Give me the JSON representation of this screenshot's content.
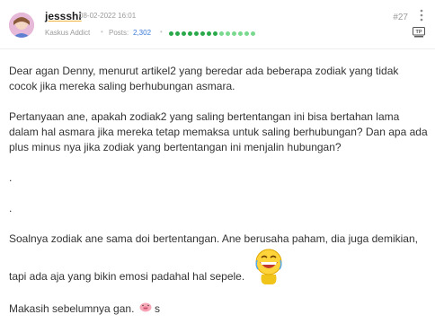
{
  "post": {
    "username": "jessshi",
    "date": "08-02-2022 16:01",
    "rank": "Kaskus Addict",
    "posts_label": "Posts:",
    "posts_count": "2,302",
    "post_number": "#27",
    "reputation_filled": 8,
    "reputation_total": 14,
    "colors": {
      "accent_underline": "#f0b23a",
      "posts_count": "#3b7bd8",
      "reputation": "#2aa94b"
    },
    "icons": {
      "avatar": "avatar",
      "more": "more-vertical-icon",
      "tp": "tp-badge-icon",
      "emoji_laugh": "laughing-emoji-icon",
      "emoji_pig": "pig-emoji-icon"
    }
  },
  "content": {
    "p1": "Dear agan Denny, menurut artikel2 yang beredar ada beberapa zodiak yang tidak cocok jika mereka saling berhubungan asmara.",
    "p2": "Pertanyaan ane, apakah zodiak2 yang saling bertentangan ini bisa bertahan lama dalam hal asmara jika mereka tetap memaksa untuk saling berhubungan? Dan apa ada plus minus nya jika zodiak yang bertentangan ini menjalin hubungan?",
    "dot1": ".",
    "dot2": ".",
    "p3": "Soalnya zodiak ane sama doi bertentangan. Ane berusaha paham, dia juga demikian,",
    "p4": "tapi ada aja yang bikin emosi padahal hal sepele.",
    "p5": "Makasih sebelumnya gan.",
    "p5_tail": "s"
  }
}
